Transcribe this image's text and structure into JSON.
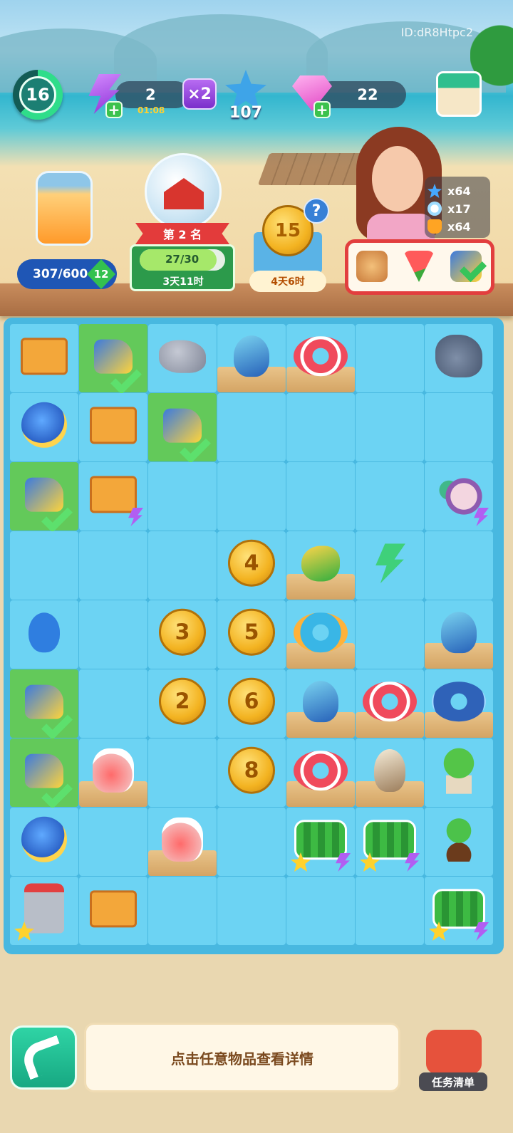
{
  "player_id": "ID:dR8Htpc2",
  "hud": {
    "level": "16",
    "energy": "2",
    "energy_timer": "01:08",
    "multiplier": "×2",
    "stars": "107",
    "gems": "22"
  },
  "jar": {
    "progress_text": "307/600",
    "level": "12"
  },
  "event": {
    "rank": "第 2 名",
    "progress_text": "27/30",
    "progress": 0.9,
    "time_left": "3天11时"
  },
  "coin_event": {
    "coin_value": "15",
    "help": "?",
    "time_left": "4天6时"
  },
  "rewards": [
    {
      "icon": "blue-star-icon",
      "text": "x64"
    },
    {
      "icon": "snowflake-icon",
      "text": "x17"
    },
    {
      "icon": "honey-drop-icon",
      "text": "x64"
    }
  ],
  "order_items": [
    {
      "icon": "seashell-icon",
      "done": false
    },
    {
      "icon": "watermelon-slice-icon",
      "done": false
    },
    {
      "icon": "beach-scoop-icon",
      "done": true
    }
  ],
  "board": {
    "rows": 9,
    "cols": 7,
    "cells": [
      [
        {
          "item": "crate"
        },
        {
          "item": "scoop",
          "hl": true,
          "check": true
        },
        {
          "item": "rock"
        },
        {
          "item": "bird",
          "sand": true
        },
        {
          "item": "ring",
          "sand": true
        },
        {
          "item": ""
        },
        {
          "item": "rockplant"
        }
      ],
      [
        {
          "item": "watering"
        },
        {
          "item": "crate"
        },
        {
          "item": "scoop",
          "hl": true,
          "check": true
        },
        {
          "item": ""
        },
        {
          "item": ""
        },
        {
          "item": ""
        },
        {
          "item": ""
        }
      ],
      [
        {
          "item": "scoop",
          "hl": true,
          "check": true
        },
        {
          "item": "crate",
          "bolt": true
        },
        {
          "item": ""
        },
        {
          "item": ""
        },
        {
          "item": ""
        },
        {
          "item": ""
        },
        {
          "item": "coral",
          "bolt": true
        }
      ],
      [
        {
          "item": ""
        },
        {
          "item": ""
        },
        {
          "item": ""
        },
        {
          "item": "coin",
          "label": "4"
        },
        {
          "item": "parrot",
          "sand": true
        },
        {
          "item": "bolt"
        },
        {
          "item": ""
        }
      ],
      [
        {
          "item": "spade"
        },
        {
          "item": ""
        },
        {
          "item": "coin",
          "label": "3"
        },
        {
          "item": "coin",
          "label": "5"
        },
        {
          "item": "ring-blue",
          "sand": true
        },
        {
          "item": ""
        },
        {
          "item": "bird",
          "sand": true
        }
      ],
      [
        {
          "item": "scoop",
          "hl": true,
          "check": true
        },
        {
          "item": ""
        },
        {
          "item": "coin",
          "label": "2"
        },
        {
          "item": "coin",
          "label": "6"
        },
        {
          "item": "bird",
          "sand": true
        },
        {
          "item": "ring",
          "sand": true
        },
        {
          "item": "ring-orca",
          "sand": true
        }
      ],
      [
        {
          "item": "scoop",
          "hl": true,
          "check": true
        },
        {
          "item": "jug",
          "sand": true
        },
        {
          "item": ""
        },
        {
          "item": "coin",
          "label": "8"
        },
        {
          "item": "ring",
          "sand": true
        },
        {
          "item": "seagull",
          "sand": true
        },
        {
          "item": "plant"
        }
      ],
      [
        {
          "item": "watering"
        },
        {
          "item": ""
        },
        {
          "item": "jug",
          "sand": true
        },
        {
          "item": ""
        },
        {
          "item": "melon",
          "star": true,
          "bolt": true
        },
        {
          "item": "melon",
          "star": true,
          "bolt": true
        },
        {
          "item": "sprout"
        }
      ],
      [
        {
          "item": "machine",
          "star": true
        },
        {
          "item": "crate"
        },
        {
          "item": ""
        },
        {
          "item": ""
        },
        {
          "item": ""
        },
        {
          "item": ""
        },
        {
          "item": "melon",
          "star": true,
          "bolt": true
        }
      ]
    ]
  },
  "footer": {
    "hint": "点击任意物品查看详情",
    "tasks_label": "任务清单"
  },
  "colors": {
    "board_bg": "#48b8e0",
    "cell_bg": "#6cd3f3",
    "cell_highlight": "#63c95a",
    "accent_green": "#2fd4a5"
  }
}
